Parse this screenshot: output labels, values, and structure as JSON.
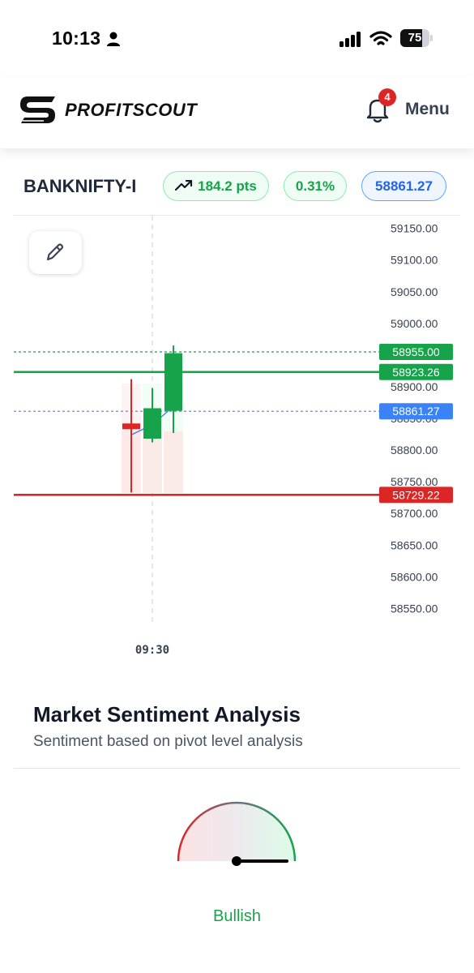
{
  "status_bar": {
    "time": "10:13",
    "battery": "75",
    "battery_level": 0.75
  },
  "header": {
    "brand": "PROFITSCOUT",
    "notification_count": "4",
    "menu_label": "Menu"
  },
  "ticker": {
    "symbol": "BANKNIFTY-I",
    "change": "184.2 pts",
    "change_pct": "0.31%",
    "price": "58861.27"
  },
  "colors": {
    "up": "#16a34a",
    "down": "#dc2626",
    "price": "#3b82f6",
    "accent_green": "#16a34a"
  },
  "chart_data": {
    "type": "candlestick",
    "y_ticks": [
      "59150.00",
      "59100.00",
      "59050.00",
      "59000.00",
      "58955.00",
      "58923.26",
      "58900.00",
      "58861.27",
      "58850.00",
      "58800.00",
      "58750.00",
      "58729.22",
      "58700.00",
      "58650.00",
      "58600.00",
      "58550.00"
    ],
    "ylim": [
      58530,
      59170
    ],
    "x_tick_labels": [
      {
        "label": "09:30",
        "index": 1
      }
    ],
    "candles": [
      {
        "open": 58842,
        "high": 58912,
        "low": 58733,
        "close": 58833
      },
      {
        "open": 58818,
        "high": 58898,
        "low": 58812,
        "close": 58866
      },
      {
        "open": 58862,
        "high": 58965,
        "low": 58827,
        "close": 58953
      }
    ],
    "crosshair_index": 1,
    "ma_line": [
      58824,
      58840,
      58869
    ],
    "levels": [
      {
        "name": "high",
        "value": 58955.0,
        "label": "58955.00",
        "color": "#16a34a",
        "style": "dotted"
      },
      {
        "name": "resistance",
        "value": 58923.26,
        "label": "58923.26",
        "color": "#16a34a",
        "style": "solid"
      },
      {
        "name": "price",
        "value": 58861.27,
        "label": "58861.27",
        "color": "#3b82f6",
        "style": "dotted"
      },
      {
        "name": "support",
        "value": 58729.22,
        "label": "58729.22",
        "color": "#dc2626",
        "style": "solid"
      }
    ]
  },
  "sentiment": {
    "title": "Market Sentiment Analysis",
    "subtitle": "Sentiment based on pivot level analysis",
    "label": "Bullish",
    "gauge_value": 1.0
  }
}
